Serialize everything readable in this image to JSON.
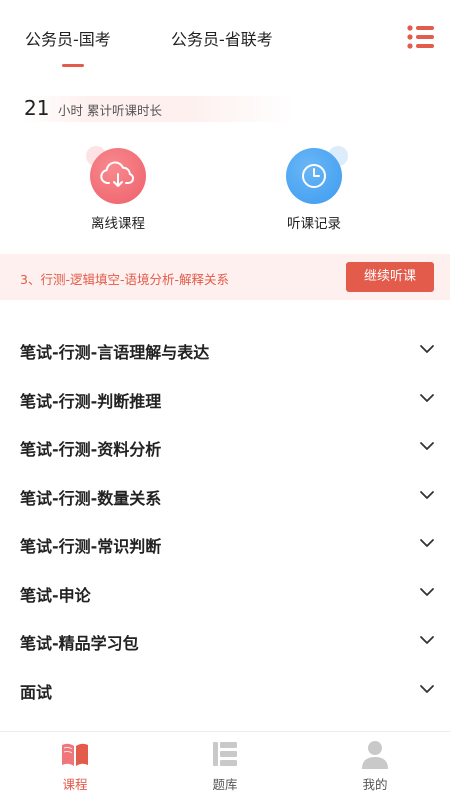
{
  "header": {
    "tabs": [
      {
        "label": "公务员-国考",
        "active": true
      },
      {
        "label": "公务员-省联考",
        "active": false
      }
    ],
    "menu_icon": "list-menu-icon"
  },
  "stats": {
    "hours_value": "21",
    "hours_label": "小时 累计听课时长"
  },
  "quick_actions": [
    {
      "label": "离线课程",
      "icon": "cloud-download-icon",
      "color": "#f0606a"
    },
    {
      "label": "听课记录",
      "icon": "clock-icon",
      "color": "#3d9cf0"
    }
  ],
  "continue_banner": {
    "text": "3、行测-逻辑填空-语境分析-解释关系",
    "button_label": "继续听课"
  },
  "courses": [
    {
      "label": "笔试-行测-言语理解与表达"
    },
    {
      "label": "笔试-行测-判断推理"
    },
    {
      "label": "笔试-行测-资料分析"
    },
    {
      "label": "笔试-行测-数量关系"
    },
    {
      "label": "笔试-行测-常识判断"
    },
    {
      "label": "笔试-申论"
    },
    {
      "label": "笔试-精品学习包"
    },
    {
      "label": "面试"
    }
  ],
  "bottom_nav": [
    {
      "label": "课程",
      "icon": "book-icon",
      "active": true
    },
    {
      "label": "题库",
      "icon": "question-bank-icon",
      "active": false
    },
    {
      "label": "我的",
      "icon": "user-icon",
      "active": false
    }
  ],
  "colors": {
    "accent": "#e35b4a",
    "banner_bg": "#fdf0ee"
  }
}
